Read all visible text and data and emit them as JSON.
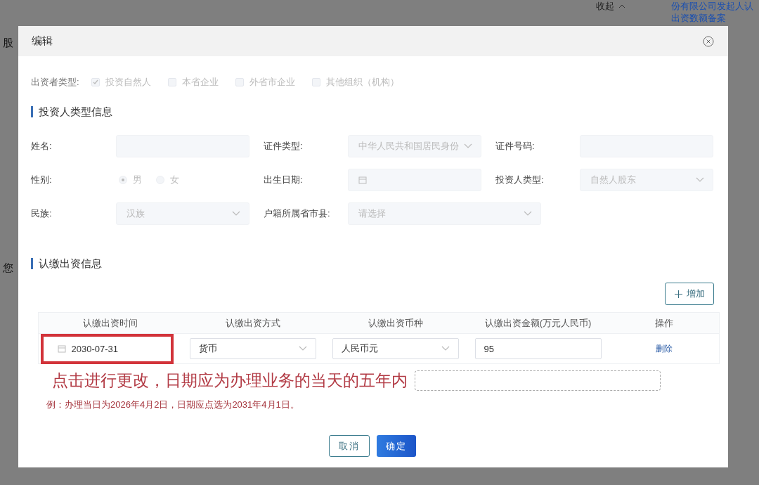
{
  "background": {
    "collapse": "收起",
    "link_lines": [
      "份有限公司发起人认",
      "出资数额备案"
    ],
    "left_texts": [
      "股",
      "您"
    ]
  },
  "dialog": {
    "title": "编辑",
    "investor_type": {
      "label": "出资者类型:",
      "options": [
        {
          "label": "投资自然人",
          "checked": true,
          "disabled": true
        },
        {
          "label": "本省企业",
          "checked": false,
          "disabled": true
        },
        {
          "label": "外省市企业",
          "checked": false,
          "disabled": true
        },
        {
          "label": "其他组织（机构）",
          "checked": false,
          "disabled": true
        }
      ]
    },
    "section_investor": "投资人类型信息",
    "fields": [
      {
        "label": "姓名:",
        "kind": "input",
        "disabled": true
      },
      {
        "label": "证件类型:",
        "kind": "select",
        "value": "中华人民共和国居民身份",
        "disabled": true
      },
      {
        "label": "证件号码:",
        "kind": "input",
        "disabled": true
      },
      {
        "label": "性别:",
        "kind": "radio",
        "disabled": true,
        "options": [
          {
            "label": "男",
            "selected": true
          },
          {
            "label": "女",
            "selected": false
          }
        ]
      },
      {
        "label": "出生日期:",
        "kind": "date",
        "disabled": true
      },
      {
        "label": "投资人类型:",
        "kind": "select",
        "value": "自然人股东",
        "disabled": true
      },
      {
        "label": "民族:",
        "kind": "select",
        "value": "汉族",
        "disabled": true
      },
      {
        "label": "户籍所属省市县:",
        "kind": "select",
        "placeholder": "请选择",
        "wide": true,
        "disabled": true
      }
    ],
    "section_capital": "认缴出资信息",
    "add_button": "增加",
    "table": {
      "columns": [
        "认缴出资时间",
        "认缴出资方式",
        "认缴出资币种",
        "认缴出资金额(万元人民币)",
        "操作"
      ],
      "rows": [
        {
          "date": "2030-07-31",
          "method": "货币",
          "currency": "人民币元",
          "amount": "95",
          "action": "删除"
        }
      ]
    },
    "annotation": {
      "headline": "点击进行更改，日期应为办理业务的当天的五年内",
      "example": "例：办理当日为2026年4月2日，日期应点选为2031年4月1日。"
    },
    "buttons": [
      {
        "label": "取消",
        "kind": "secondary"
      },
      {
        "label": "确定",
        "kind": "primary"
      }
    ]
  }
}
